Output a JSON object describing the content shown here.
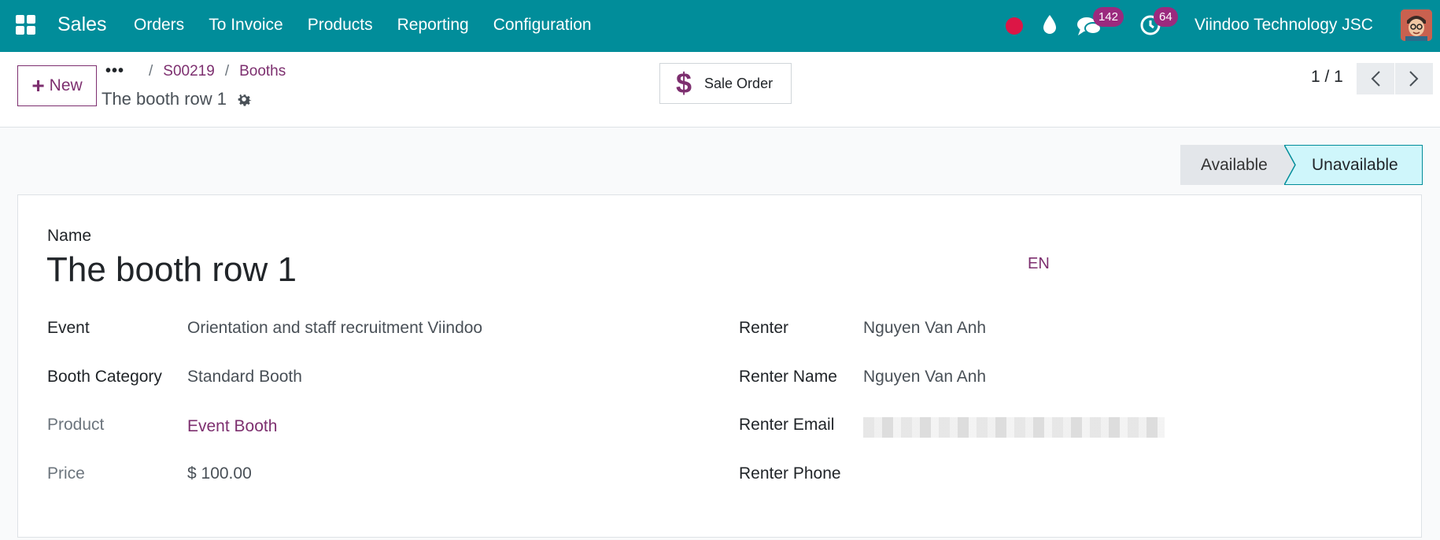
{
  "navbar": {
    "brand": "Sales",
    "menu": [
      "Orders",
      "To Invoice",
      "Products",
      "Reporting",
      "Configuration"
    ],
    "chat_count": "142",
    "activity_count": "64",
    "company": "Viindoo Technology JSC"
  },
  "control_panel": {
    "new_label": "New",
    "breadcrumbs": [
      "S00219",
      "Booths"
    ],
    "record_title": "The booth row 1",
    "smart_button": "Sale Order",
    "pager": "1 / 1"
  },
  "status": {
    "stages": [
      "Available",
      "Unavailable"
    ],
    "active": "Unavailable"
  },
  "form": {
    "name_label": "Name",
    "name_value": "The booth row 1",
    "lang": "EN",
    "left": [
      {
        "label": "Event",
        "value": "Orientation and staff recruitment Viindoo"
      },
      {
        "label": "Booth Category",
        "value": "Standard Booth"
      },
      {
        "label": "Product",
        "value": "Event Booth"
      },
      {
        "label": "Price",
        "value": "$ 100.00"
      }
    ],
    "right": [
      {
        "label": "Renter",
        "value": "Nguyen Van Anh"
      },
      {
        "label": "Renter Name",
        "value": "Nguyen Van Anh"
      },
      {
        "label": "Renter Email",
        "value": ""
      },
      {
        "label": "Renter Phone",
        "value": ""
      }
    ]
  },
  "colors": {
    "navbar": "#018d9a",
    "accent": "#7d2f6f",
    "active_stage": "#cff6fb"
  }
}
